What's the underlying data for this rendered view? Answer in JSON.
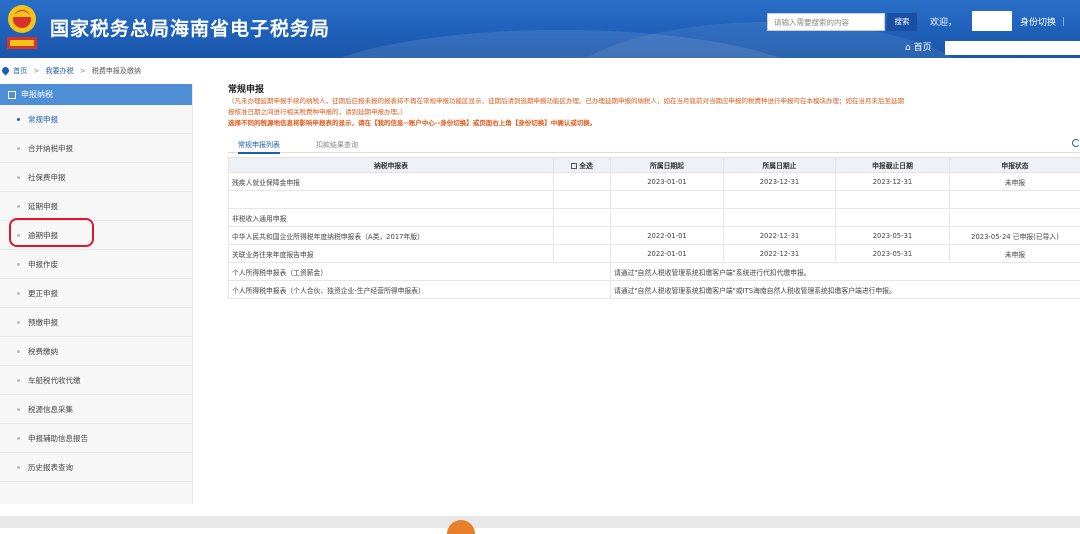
{
  "header": {
    "title": "国家税务总局海南省电子税务局",
    "search_placeholder": "请输入需要搜索的内容",
    "search_button": "搜索",
    "welcome": "欢迎，",
    "switch_identity": "身份切换 ｜",
    "home": "首页"
  },
  "breadcrumb": [
    "首页",
    "我要办税",
    "税费申报及缴纳"
  ],
  "sidebar": {
    "heading": "申报纳税",
    "items": [
      {
        "label": "常规申报",
        "active": true
      },
      {
        "label": "合并纳税申报"
      },
      {
        "label": "社保费申报"
      },
      {
        "label": "延期申报"
      },
      {
        "label": "逾期申报"
      },
      {
        "label": "申报作废"
      },
      {
        "label": "更正申报"
      },
      {
        "label": "预缴申报"
      },
      {
        "label": "税费缴纳"
      },
      {
        "label": "车船税代收代缴"
      },
      {
        "label": "税源信息采集"
      },
      {
        "label": "申报辅助信息报告"
      },
      {
        "label": "历史报表查询"
      }
    ]
  },
  "main": {
    "title": "常规申报",
    "notice_line1": "（凡未办理延期申报手续的纳税人，征期后应报未报的报表将不再在常规申报功能区显示，征期后请到逾期申报功能区办理。已办理延期申报的纳税人，如在当月底前对当期应申报的税费种进行申报可在本模块办理；如在当月末后至延期",
    "notice_line2": "报核准日期之间进行相关税费种申报的，请到延期申报办理。）",
    "notice_line3": "选择不同的税源地信息将影响申报表的显示，请在【我的信息--账户中心--身份切换】或页面右上角【身份切换】中确认或切换。",
    "tabs": [
      "常规申报列表",
      "扣款结果查询"
    ],
    "table": {
      "headers": [
        "纳税申报表",
        "全选",
        "所属日期起",
        "所属日期止",
        "申报截止日期",
        "申报状态"
      ],
      "rows": [
        {
          "name": "残疾人就业保障金申报",
          "start": "2023-01-01",
          "end": "2023-12-31",
          "deadline": "2023-12-31",
          "status": "未申报"
        },
        {
          "name": "",
          "start": "",
          "end": "",
          "deadline": "",
          "status": ""
        },
        {
          "name": "非税收入通用申报",
          "start": "",
          "end": "",
          "deadline": "",
          "status": ""
        },
        {
          "name": "中华人民共和国企业所得税年度纳税申报表（A类，2017年版）",
          "start": "2022-01-01",
          "end": "2022-12-31",
          "deadline": "2023-05-31",
          "status": "2023-05-24 已申报(已导入)"
        },
        {
          "name": "关联业务往来年度报告申报",
          "start": "2022-01-01",
          "end": "2022-12-31",
          "deadline": "2023-05-31",
          "status": "未申报"
        },
        {
          "name": "个人所得税申报表（工资薪金）",
          "merged": "请通过\"自然人税收管理系统扣缴客户端\"系统进行代扣代缴申报。"
        },
        {
          "name": "个人所得税申报表（个人合伙、独资企业-生产经营所得申报表）",
          "merged": "请通过\"自然人税收管理系统扣缴客户端\"或ITS海南自然人税收管理系统扣缴客户端进行申报。"
        }
      ]
    }
  }
}
